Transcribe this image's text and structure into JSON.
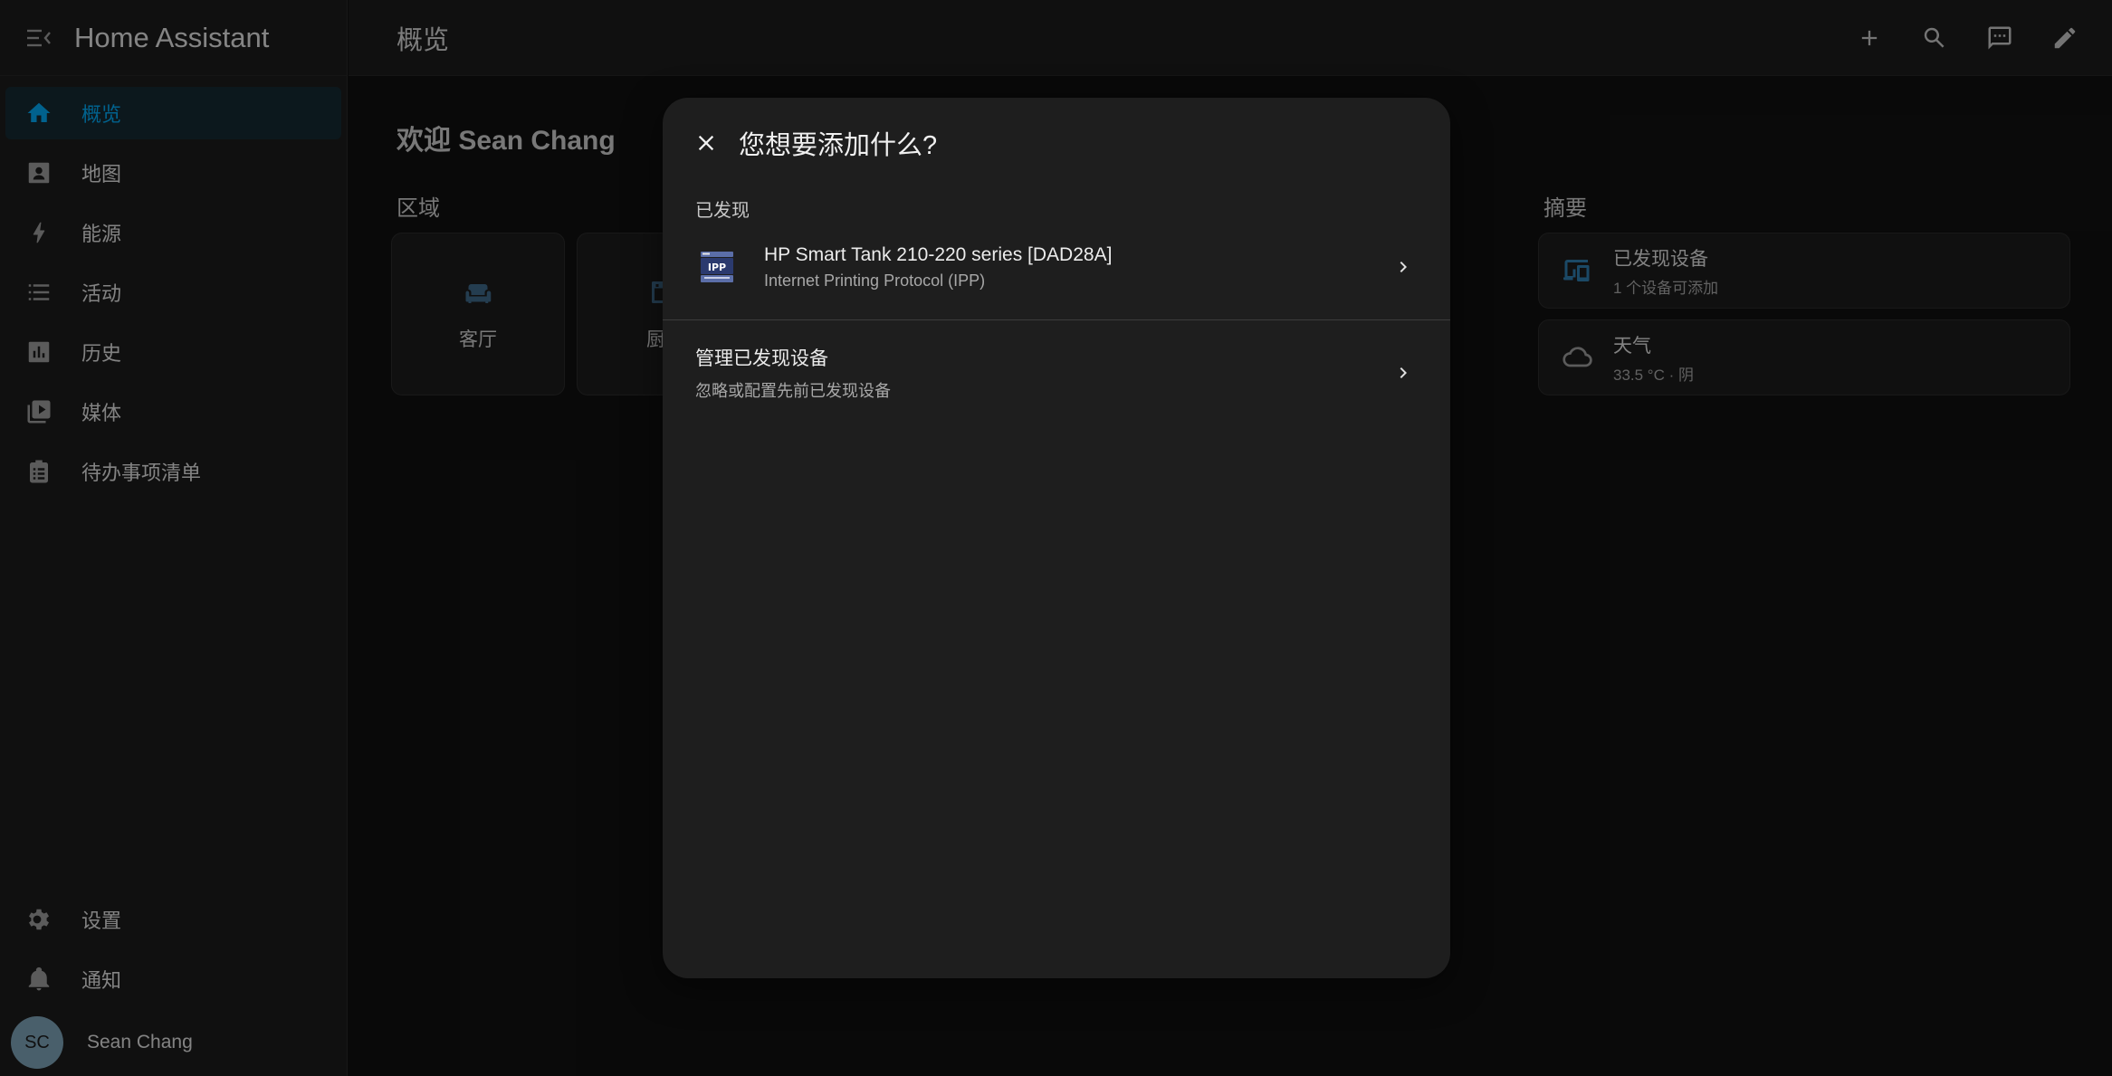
{
  "sidebar": {
    "title": "Home Assistant",
    "items": [
      {
        "label": "概览",
        "icon": "home-icon",
        "active": true
      },
      {
        "label": "地图",
        "icon": "map-icon"
      },
      {
        "label": "能源",
        "icon": "lightning-icon"
      },
      {
        "label": "活动",
        "icon": "list-icon"
      },
      {
        "label": "历史",
        "icon": "chart-icon"
      },
      {
        "label": "媒体",
        "icon": "media-icon"
      },
      {
        "label": "待办事项清单",
        "icon": "clipboard-icon"
      }
    ],
    "bottom": [
      {
        "label": "设置",
        "icon": "gear-icon"
      },
      {
        "label": "通知",
        "icon": "bell-icon"
      }
    ],
    "user": {
      "initials": "SC",
      "name": "Sean Chang"
    }
  },
  "topbar": {
    "title": "概览",
    "actions": [
      "plus-icon",
      "search-icon",
      "chat-icon",
      "pencil-icon"
    ]
  },
  "main": {
    "welcome": "欢迎 Sean Chang",
    "areas_title": "区域",
    "areas": [
      {
        "label": "客厅",
        "icon": "sofa-icon"
      },
      {
        "label": "厨",
        "icon": "kitchen-icon"
      }
    ],
    "summary_title": "摘要",
    "summary": [
      {
        "title": "已发现设备",
        "subtitle": "1 个设备可添加",
        "icon": "devices-icon"
      },
      {
        "title": "天气",
        "subtitle": "33.5 °C · 阴",
        "icon": "cloud-icon"
      }
    ]
  },
  "dialog": {
    "title": "您想要添加什么?",
    "section": "已发现",
    "discovered": {
      "name": "HP Smart Tank 210-220 series [DAD28A]",
      "protocol": "Internet Printing Protocol (IPP)",
      "logo_text": "IPP"
    },
    "manage": {
      "title": "管理已发现设备",
      "subtitle": "忽略或配置先前已发现设备"
    }
  },
  "colors": {
    "accent": "#03a9f4",
    "icon": "#9e9e9e",
    "background": "#111111",
    "card": "#1c1c1c"
  }
}
